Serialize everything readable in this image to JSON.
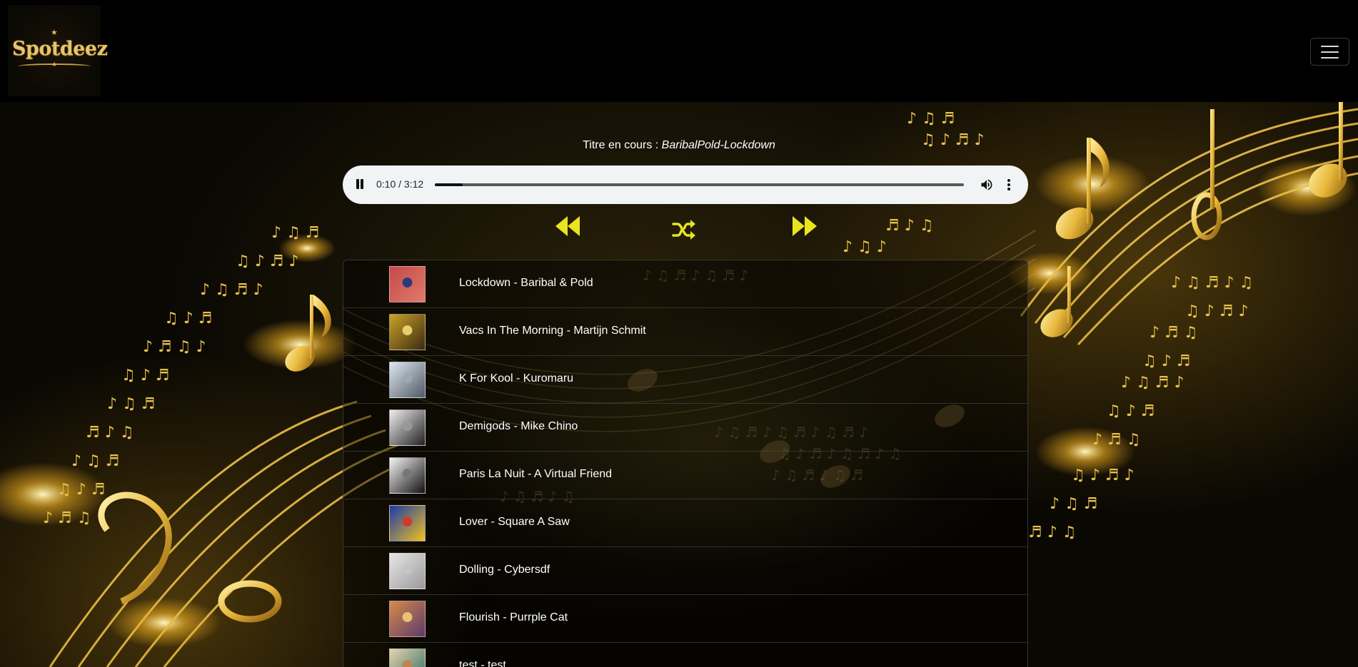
{
  "header": {
    "logo_text": "Spotdeez",
    "menu_icon": "hamburger-menu-icon"
  },
  "now_playing": {
    "prefix": "Titre en cours : ",
    "title": "BaribalPold-Lockdown"
  },
  "player": {
    "state": "playing",
    "time": "0:10 / 3:12",
    "progress": 0.053,
    "icons": [
      "pause-icon",
      "volume-icon",
      "more-vertical-icon"
    ]
  },
  "controls": {
    "accent": "#e8e41e",
    "buttons": [
      "previous-icon",
      "shuffle-icon",
      "next-icon"
    ]
  },
  "playlist": [
    {
      "label": "Lockdown - Baribal & Pold",
      "cover": [
        "#c44a4a",
        "#e07a6a",
        "#2a3a7a"
      ]
    },
    {
      "label": "Vacs In The Morning - Martijn Schmit",
      "cover": [
        "#c9a227",
        "#3b2a12",
        "#e8cf6a"
      ]
    },
    {
      "label": "K For Kool - Kuromaru",
      "cover": [
        "#dfe6ee",
        "#4f5a66",
        "#9aa8b6"
      ]
    },
    {
      "label": "Demigods - Mike Chino",
      "cover": [
        "#eeeeee",
        "#222222",
        "#999999"
      ]
    },
    {
      "label": " Paris La Nuit - A Virtual Friend",
      "cover": [
        "#f4f4f4",
        "#111111",
        "#777777"
      ]
    },
    {
      "label": " Lover - Square A Saw",
      "cover": [
        "#1b3ba8",
        "#f0c020",
        "#d03a2a"
      ]
    },
    {
      "label": "Dolling - Cybersdf",
      "cover": [
        "#e6e6e6",
        "#9a9a9a",
        "#c4c4c4"
      ]
    },
    {
      "label": "Flourish - Purrple Cat",
      "cover": [
        "#d98a4a",
        "#5b3a6b",
        "#e9c27a"
      ]
    },
    {
      "label": "test - test",
      "cover": [
        "#e9d3a9",
        "#2b6a6a",
        "#b9884a"
      ]
    }
  ]
}
